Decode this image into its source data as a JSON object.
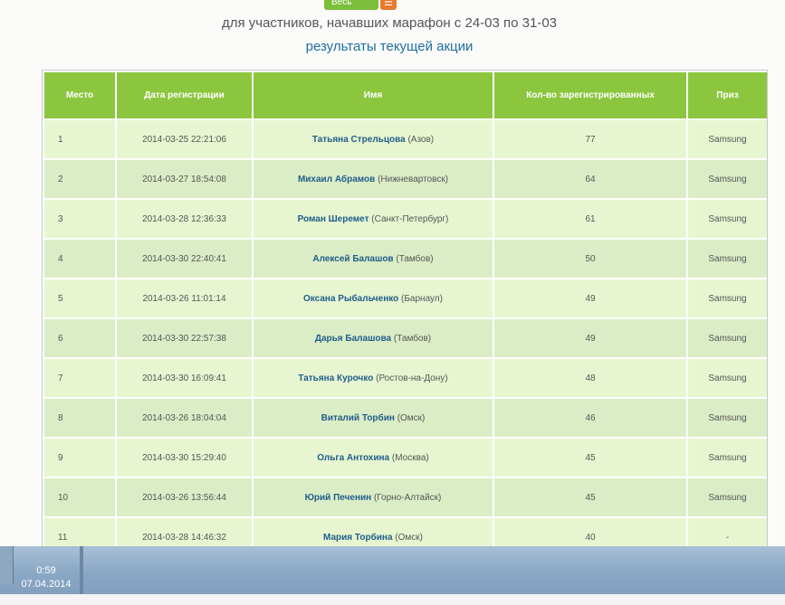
{
  "header": {
    "dropdown_label": "Весь",
    "dropdown_icon": "list-icon",
    "subtitle": "для участников, начавших марафон с 24-03 по 31-03",
    "results_link": "результаты текущей акции"
  },
  "table": {
    "columns": [
      "Место",
      "Дата регистрации",
      "Имя",
      "Кол-во зарегистрированных",
      "Приз"
    ],
    "rows": [
      {
        "place": "1",
        "date": "2014-03-25 22:21:06",
        "name": "Татьяна Стрельцова",
        "city": "(Азов)",
        "count": "77",
        "prize": "Samsung"
      },
      {
        "place": "2",
        "date": "2014-03-27 18:54:08",
        "name": "Михаил Абрамов",
        "city": "(Нижневартовск)",
        "count": "64",
        "prize": "Samsung"
      },
      {
        "place": "3",
        "date": "2014-03-28 12:36:33",
        "name": "Роман Шеремет",
        "city": "(Санкт-Петербург)",
        "count": "61",
        "prize": "Samsung"
      },
      {
        "place": "4",
        "date": "2014-03-30 22:40:41",
        "name": "Алексей Балашов",
        "city": "(Тамбов)",
        "count": "50",
        "prize": "Samsung"
      },
      {
        "place": "5",
        "date": "2014-03-26 11:01:14",
        "name": "Оксана Рыбальченко",
        "city": "(Барнаул)",
        "count": "49",
        "prize": "Samsung"
      },
      {
        "place": "6",
        "date": "2014-03-30 22:57:38",
        "name": "Дарья Балашова",
        "city": "(Тамбов)",
        "count": "49",
        "prize": "Samsung"
      },
      {
        "place": "7",
        "date": "2014-03-30 16:09:41",
        "name": "Татьяна Курочко",
        "city": "(Ростов-на-Дону)",
        "count": "48",
        "prize": "Samsung"
      },
      {
        "place": "8",
        "date": "2014-03-26 18:04:04",
        "name": "Виталий Торбин",
        "city": "(Омск)",
        "count": "46",
        "prize": "Samsung"
      },
      {
        "place": "9",
        "date": "2014-03-30 15:29:40",
        "name": "Ольга Антохина",
        "city": "(Москва)",
        "count": "45",
        "prize": "Samsung"
      },
      {
        "place": "10",
        "date": "2014-03-26 13:56:44",
        "name": "Юрий Печенин",
        "city": "(Горно-Алтайск)",
        "count": "45",
        "prize": "Samsung"
      },
      {
        "place": "11",
        "date": "2014-03-28 14:46:32",
        "name": "Мария Торбина",
        "city": "(Омск)",
        "count": "40",
        "prize": "-"
      }
    ]
  },
  "taskbar": {
    "time": "0:59",
    "date": "07.04.2014"
  }
}
